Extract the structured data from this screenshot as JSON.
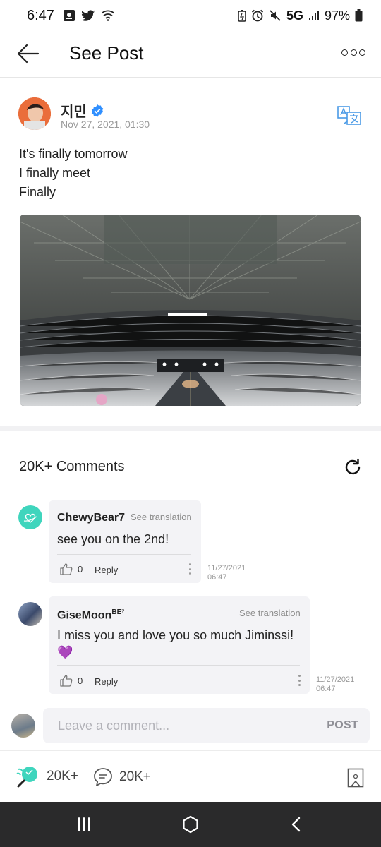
{
  "status_bar": {
    "time": "6:47",
    "network": "5G",
    "battery": "97%"
  },
  "header": {
    "title": "See Post"
  },
  "post": {
    "author": "지민",
    "date": "Nov 27, 2021, 01:30",
    "lines": [
      "It's finally tomorrow",
      "I finally meet",
      "Finally"
    ]
  },
  "comments": {
    "count_label": "20K+ Comments",
    "items": [
      {
        "author": "ChewyBear7",
        "badge": "",
        "translation_label": "See translation",
        "text": "see you on the 2nd!",
        "likes": "0",
        "reply_label": "Reply",
        "date": "11/27/2021",
        "time": "06:47"
      },
      {
        "author": "GiseMoon",
        "badge": "BE⁷",
        "translation_label": "See translation",
        "text": "I miss you and love you so much Jiminssi!",
        "emoji": "💜",
        "likes": "0",
        "reply_label": "Reply",
        "date": "11/27/2021",
        "time": "06:47"
      }
    ]
  },
  "comment_input": {
    "placeholder": "Leave a comment...",
    "post_label": "POST"
  },
  "actions": {
    "cheers_count": "20K+",
    "comments_count": "20K+"
  },
  "colors": {
    "brand": "#3fd5bd",
    "verified": "#2f8fff",
    "nav_bg": "#2a2a2b"
  }
}
